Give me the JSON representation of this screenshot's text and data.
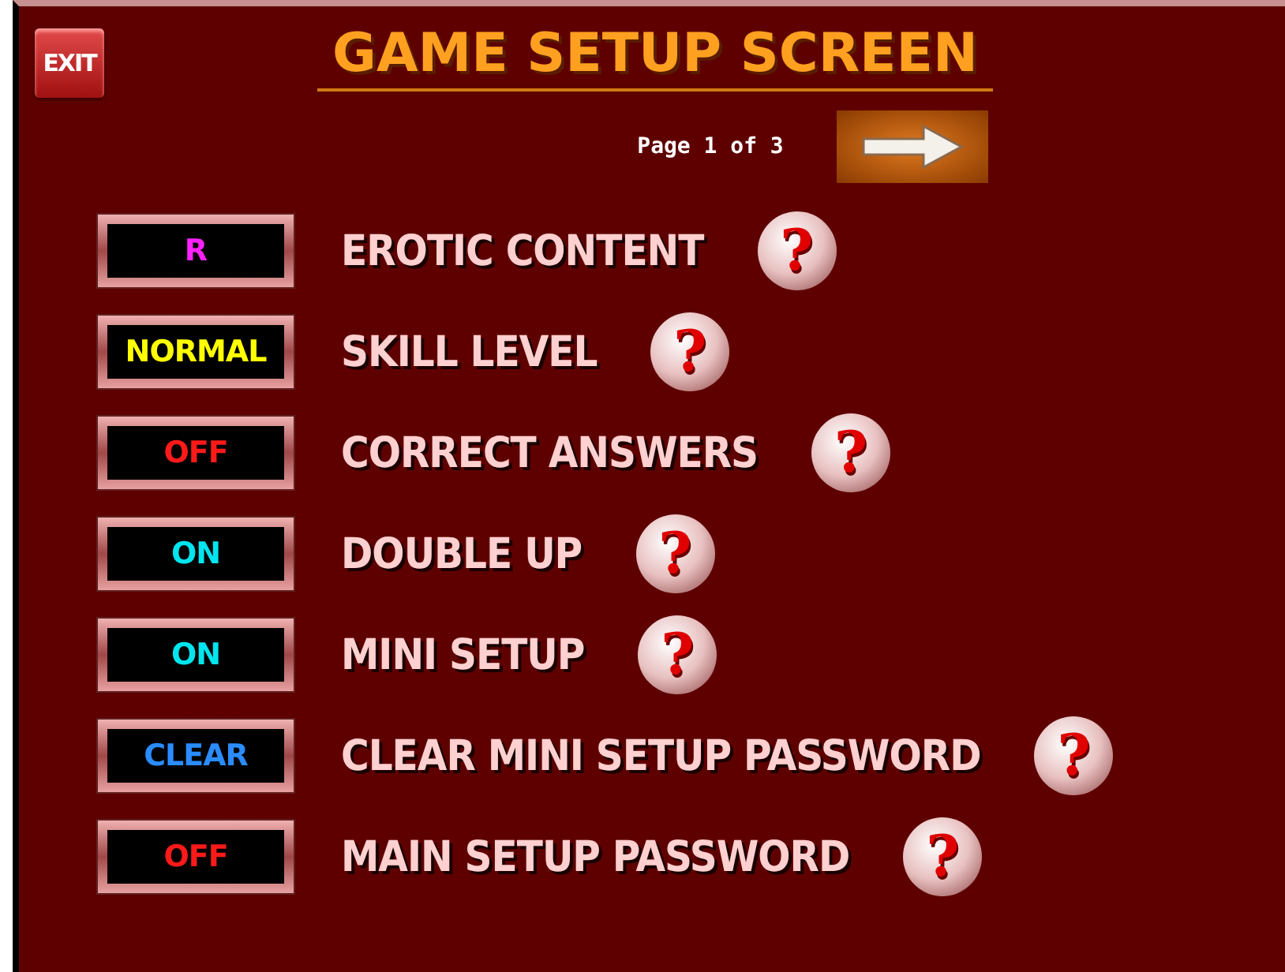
{
  "exit_button": "EXIT",
  "title": "GAME SETUP SCREEN",
  "pager": {
    "label": "Page 1 of 3"
  },
  "settings": [
    {
      "value": "R",
      "kind": "rating",
      "label": "EROTIC CONTENT",
      "help": "?"
    },
    {
      "value": "NORMAL",
      "kind": "level",
      "label": "SKILL LEVEL",
      "help": "?"
    },
    {
      "value": "OFF",
      "kind": "off",
      "label": "CORRECT ANSWERS",
      "help": "?"
    },
    {
      "value": "ON",
      "kind": "on",
      "label": "DOUBLE UP",
      "help": "?"
    },
    {
      "value": "ON",
      "kind": "on",
      "label": "MINI SETUP",
      "help": "?"
    },
    {
      "value": "CLEAR",
      "kind": "action",
      "label": "CLEAR MINI SETUP PASSWORD",
      "help": "?"
    },
    {
      "value": "OFF",
      "kind": "off",
      "label": "MAIN SETUP PASSWORD",
      "help": "?"
    }
  ]
}
